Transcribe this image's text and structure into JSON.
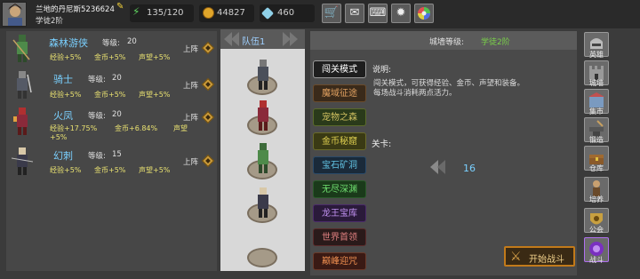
{
  "player": {
    "name": "兰地的丹尼斯5236624",
    "rank": "学徒2阶"
  },
  "resources": {
    "energy": "135/120",
    "gold": "44827",
    "gems": "460"
  },
  "top_buttons": [
    "shop-cart-icon",
    "mail-icon",
    "gamepad-icon",
    "settings-icon",
    "color-wheel-icon"
  ],
  "heroes": [
    {
      "name": "森林游侠",
      "level_label": "等级:",
      "level": "20",
      "bonus": [
        "经验+5%",
        "金币+5%",
        "声望+5%"
      ],
      "action": "上阵"
    },
    {
      "name": "骑士",
      "level_label": "等级:",
      "level": "20",
      "bonus": [
        "经验+5%",
        "金币+5%",
        "声望+5%"
      ],
      "action": "上阵"
    },
    {
      "name": "火凤",
      "level_label": "等级:",
      "level": "20",
      "bonus": [
        "经验+17.75%",
        "金币+6.84%",
        "声望",
        "+5%"
      ],
      "action": "上阵"
    },
    {
      "name": "幻刺",
      "level_label": "等级:",
      "level": "15",
      "bonus": [
        "经验+5%",
        "金币+5%",
        "声望+5%"
      ],
      "action": "上阵"
    }
  ],
  "team": {
    "label": "队伍1"
  },
  "wall": {
    "label": "城墙等级:",
    "value": "学徒2阶"
  },
  "modes": [
    "闯关模式",
    "魔域征途",
    "宠物之森",
    "金币秘窟",
    "宝石矿洞",
    "无尽深渊",
    "龙王宝库",
    "世界首领",
    "巅峰迎咒"
  ],
  "description": {
    "heading": "说明:",
    "lines": [
      "闯关模式，可获得经验、金币、声望和装备。",
      "每场战斗消耗两点活力。"
    ]
  },
  "stage": {
    "label": "关卡:",
    "value": "16"
  },
  "start_button": "开始战斗",
  "sidebar": [
    "英雄",
    "城墙",
    "集市",
    "锻造",
    "仓库",
    "培养",
    "公会",
    "战斗"
  ],
  "colors": {
    "accent_blue": "#7ad0ff",
    "accent_green": "#7ad14a",
    "bonus_yellow": "#e8e070"
  }
}
